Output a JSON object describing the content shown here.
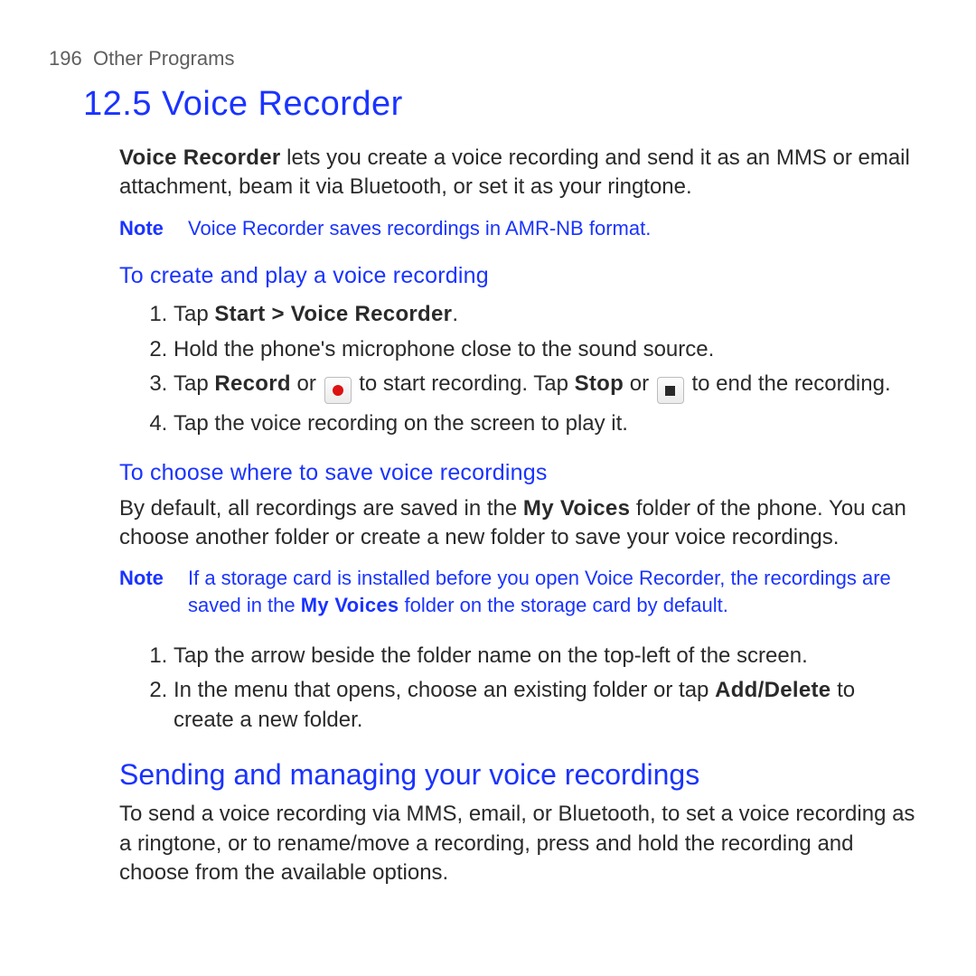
{
  "runningHead": {
    "page": "196",
    "chapter": "Other Programs"
  },
  "title": "12.5  Voice Recorder",
  "intro": {
    "lead": "Voice Recorder",
    "rest": " lets you create a voice recording and send it as an MMS or email attachment, beam it via Bluetooth, or set it as your ringtone."
  },
  "note1": {
    "label": "Note",
    "text": "Voice Recorder saves recordings in AMR-NB format."
  },
  "sec1": {
    "head": "To create and play a voice recording",
    "s1": {
      "a": "Tap ",
      "b": "Start > Voice Recorder",
      "c": "."
    },
    "s2": "Hold the phone's microphone close to the sound source.",
    "s3": {
      "a": "Tap ",
      "b": "Record",
      "c": " or ",
      "d": " to start recording. Tap ",
      "e": "Stop",
      "f": " or ",
      "g": " to end the recording."
    },
    "s4": "Tap the voice recording on the screen to play it."
  },
  "sec2": {
    "head": "To choose where to save voice recordings",
    "p": {
      "a": "By default, all recordings are saved in the ",
      "b": "My Voices",
      "c": " folder of the phone. You can choose another folder or create a new folder to save your voice recordings."
    },
    "note": {
      "label": "Note",
      "a": "If a storage card is installed before you open Voice Recorder, the recordings are saved in the ",
      "b": "My Voices",
      "c": " folder on the storage card by default."
    },
    "s1": "Tap the arrow beside the folder name on the top-left of the screen.",
    "s2": {
      "a": "In the menu that opens, choose an existing folder or tap ",
      "b": "Add/Delete",
      "c": " to create a new folder."
    }
  },
  "sec3": {
    "head": "Sending and managing your voice recordings",
    "p": "To send a voice recording via MMS, email, or Bluetooth, to set a voice recording as a ringtone, or to rename/move a recording, press and hold the recording and choose from the available options."
  }
}
